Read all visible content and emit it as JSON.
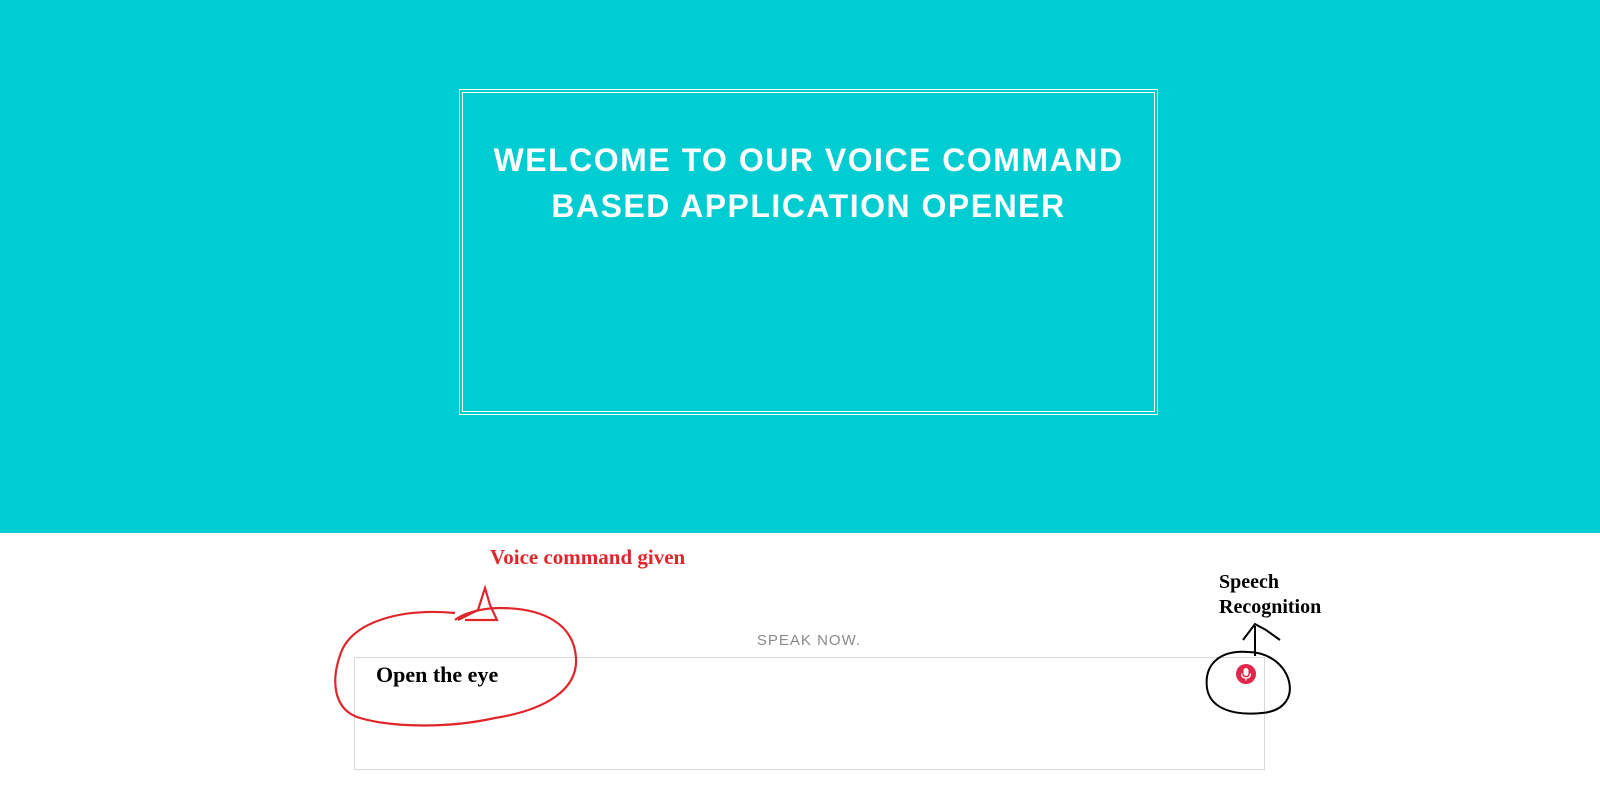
{
  "hero": {
    "title": "WELCOME TO OUR VOICE COMMAND BASED APPLICATION OPENER"
  },
  "annotations": {
    "voice_command_note": "Voice command given",
    "speech_recognition_note": "Speech Recognition"
  },
  "speech": {
    "prompt": "SPEAK NOW.",
    "transcript": "Open the eye",
    "mic_icon": "microphone-icon"
  },
  "colors": {
    "hero_background": "#00cdd1",
    "mic_button": "#e0264a",
    "annotation_red": "#e0262b",
    "annotation_black": "#000000"
  }
}
